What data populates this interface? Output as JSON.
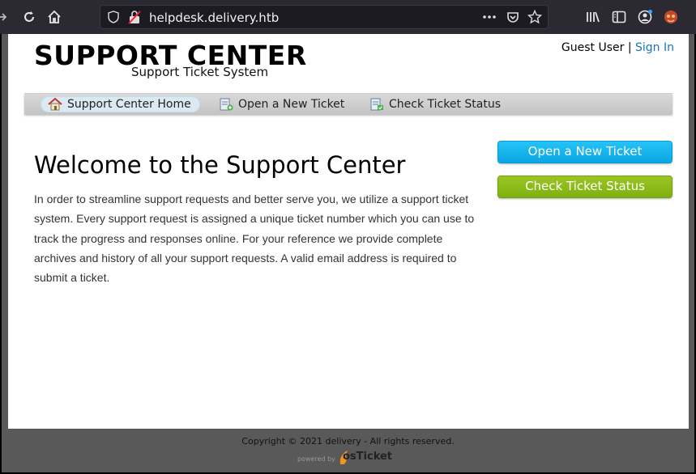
{
  "browser": {
    "url": "helpdesk.delivery.htb",
    "icons": [
      "back-icon",
      "reload-icon",
      "home-icon",
      "shield-icon",
      "no-secure-lock-icon",
      "more-icon",
      "pocket-icon",
      "star-icon",
      "library-icon",
      "sidebar-icon",
      "account-icon",
      "extension-icon"
    ]
  },
  "header": {
    "logo_title": "SUPPORT CENTER",
    "logo_subtitle": "Support Ticket System",
    "guest_label": "Guest User",
    "separator": "|",
    "sign_in": "Sign In"
  },
  "nav": {
    "items": [
      {
        "label": "Support Center Home",
        "icon": "home-icon"
      },
      {
        "label": "Open a New Ticket",
        "icon": "new-ticket-icon"
      },
      {
        "label": "Check Ticket Status",
        "icon": "ticket-status-icon"
      }
    ]
  },
  "main": {
    "title": "Welcome to the Support Center",
    "body": "In order to streamline support requests and better serve you, we utilize a support ticket system. Every support request is assigned a unique ticket number which you can use to track the progress and responses online. For your reference we provide complete archives and history of all your support requests. A valid email address is required to submit a ticket."
  },
  "sidebar": {
    "open_ticket": "Open a New Ticket",
    "check_status": "Check Ticket Status"
  },
  "footer": {
    "copyright": "Copyright © 2021 delivery - All rights reserved.",
    "powered_by": "powered by",
    "brand": "osTicket"
  },
  "colors": {
    "link": "#1a75bb",
    "open_button": "#0aa6e4",
    "check_button": "#7fb011",
    "chrome": "#2b2a33"
  }
}
